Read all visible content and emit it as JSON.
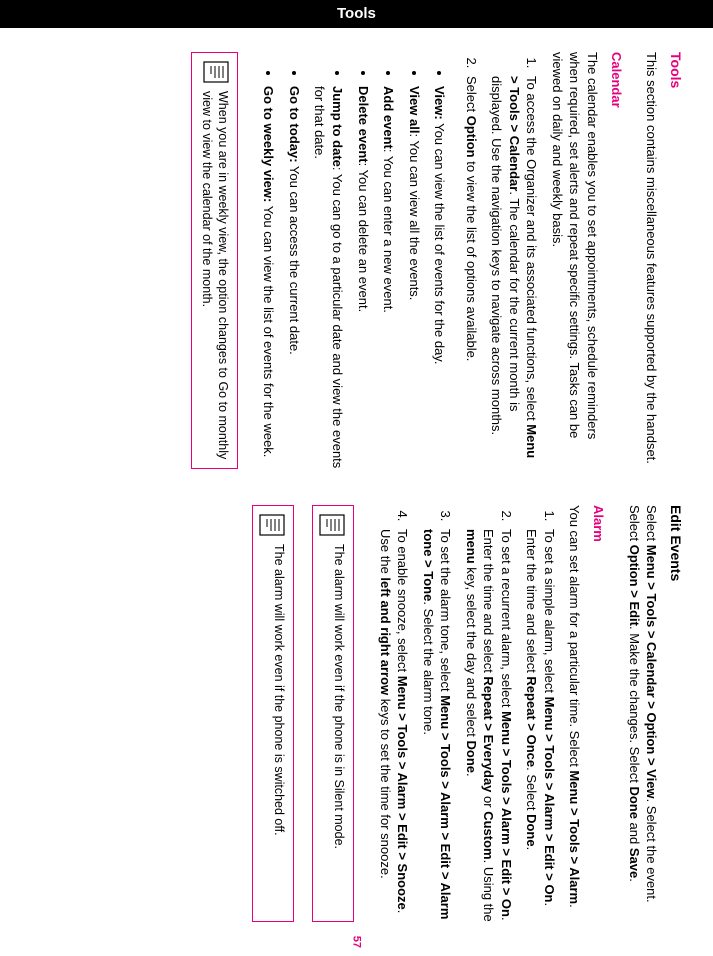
{
  "tab": "Tools",
  "pageNumber": "57",
  "left": {
    "title": "Tools",
    "intro": "This section contains miscellaneous features supported by the handset.",
    "calendar": {
      "title": "Calendar",
      "intro": "The calendar enables you to set appointments, schedule reminders when required, set alerts and repeat specific settings. Tasks can be viewed on daily and weekly basis.",
      "step1_a": "To access the Organizer and its associated functions, select ",
      "step1_b": "Menu > Tools > Calendar",
      "step1_c": ". The calendar for the current month is displayed. Use the navigation keys to navigate across months.",
      "step2_a": "Select ",
      "step2_b": "Option",
      "step2_c": " to view the list of options available.",
      "bullets": {
        "view_a": "View:",
        "view_b": " You can view the list of events for the day.",
        "viewall_a": "View all",
        "viewall_b": ": You can view all the events.",
        "addevent_a": "Add event",
        "addevent_b": ": You can enter a new event.",
        "delevent_a": "Delete event",
        "delevent_b": ": You can delete an event.",
        "jump_a": "Jump to date",
        "jump_b": ": You can go to a particular date and view the events for that date.",
        "today_a": "Go to today:",
        "today_b": " You can access the current date.",
        "weekly_a": "Go to weekly view:",
        "weekly_b": " You can view the list of events for the week."
      },
      "note": "When you are in weekly view, the option changes to Go to monthly view to view the calendar of the month."
    }
  },
  "right": {
    "editEvents": {
      "title": "Edit Events",
      "p_a": "Select ",
      "p_b": "Menu > Tools > Calendar > Option > View",
      "p_c": ". Select the event. Select ",
      "p_d": "Option > Edit",
      "p_e": ". Make the changes. Select ",
      "p_f": "Done",
      "p_g": " and ",
      "p_h": "Save",
      "p_i": "."
    },
    "alarm": {
      "title": "Alarm",
      "intro_a": "You can set alarm for a particular time. Select ",
      "intro_b": "Menu > Tools > Alarm",
      "intro_c": ".",
      "s1_a": "To set a simple alarm, select ",
      "s1_b": "Menu > Tools > Alarm > Edit > On",
      "s1_c": ". Enter the time and select ",
      "s1_d": "Repeat > Once",
      "s1_e": ". Select ",
      "s1_f": "Done",
      "s1_g": ".",
      "s2_a": "To set a recurrent alarm, select ",
      "s2_b": "Menu > Tools > Alarm > Edit > On",
      "s2_c": ". Enter the time and select ",
      "s2_d": "Repeat > Everyday",
      "s2_e": " or ",
      "s2_f": "Custom",
      "s2_g": ". Using the ",
      "s2_h": "menu",
      "s2_i": " key, select the day and select ",
      "s2_j": "Done",
      "s2_k": ".",
      "s3_a": "To set the alarm tone, select ",
      "s3_b": "Menu > Tools > Alarm > Edit > Alarm tone > Tone",
      "s3_c": ". Select the alarm tone.",
      "s4_a": "To enable snooze, select ",
      "s4_b": "Menu > Tools > Alarm > Edit > Snooze",
      "s4_c": ". Use the ",
      "s4_d": "left and right arrow",
      "s4_e": " keys to set the time for snooze.",
      "note1": "The alarm will work even if the phone is in Silent mode.",
      "note2": "The alarm will work even if the phone is switched off."
    }
  }
}
